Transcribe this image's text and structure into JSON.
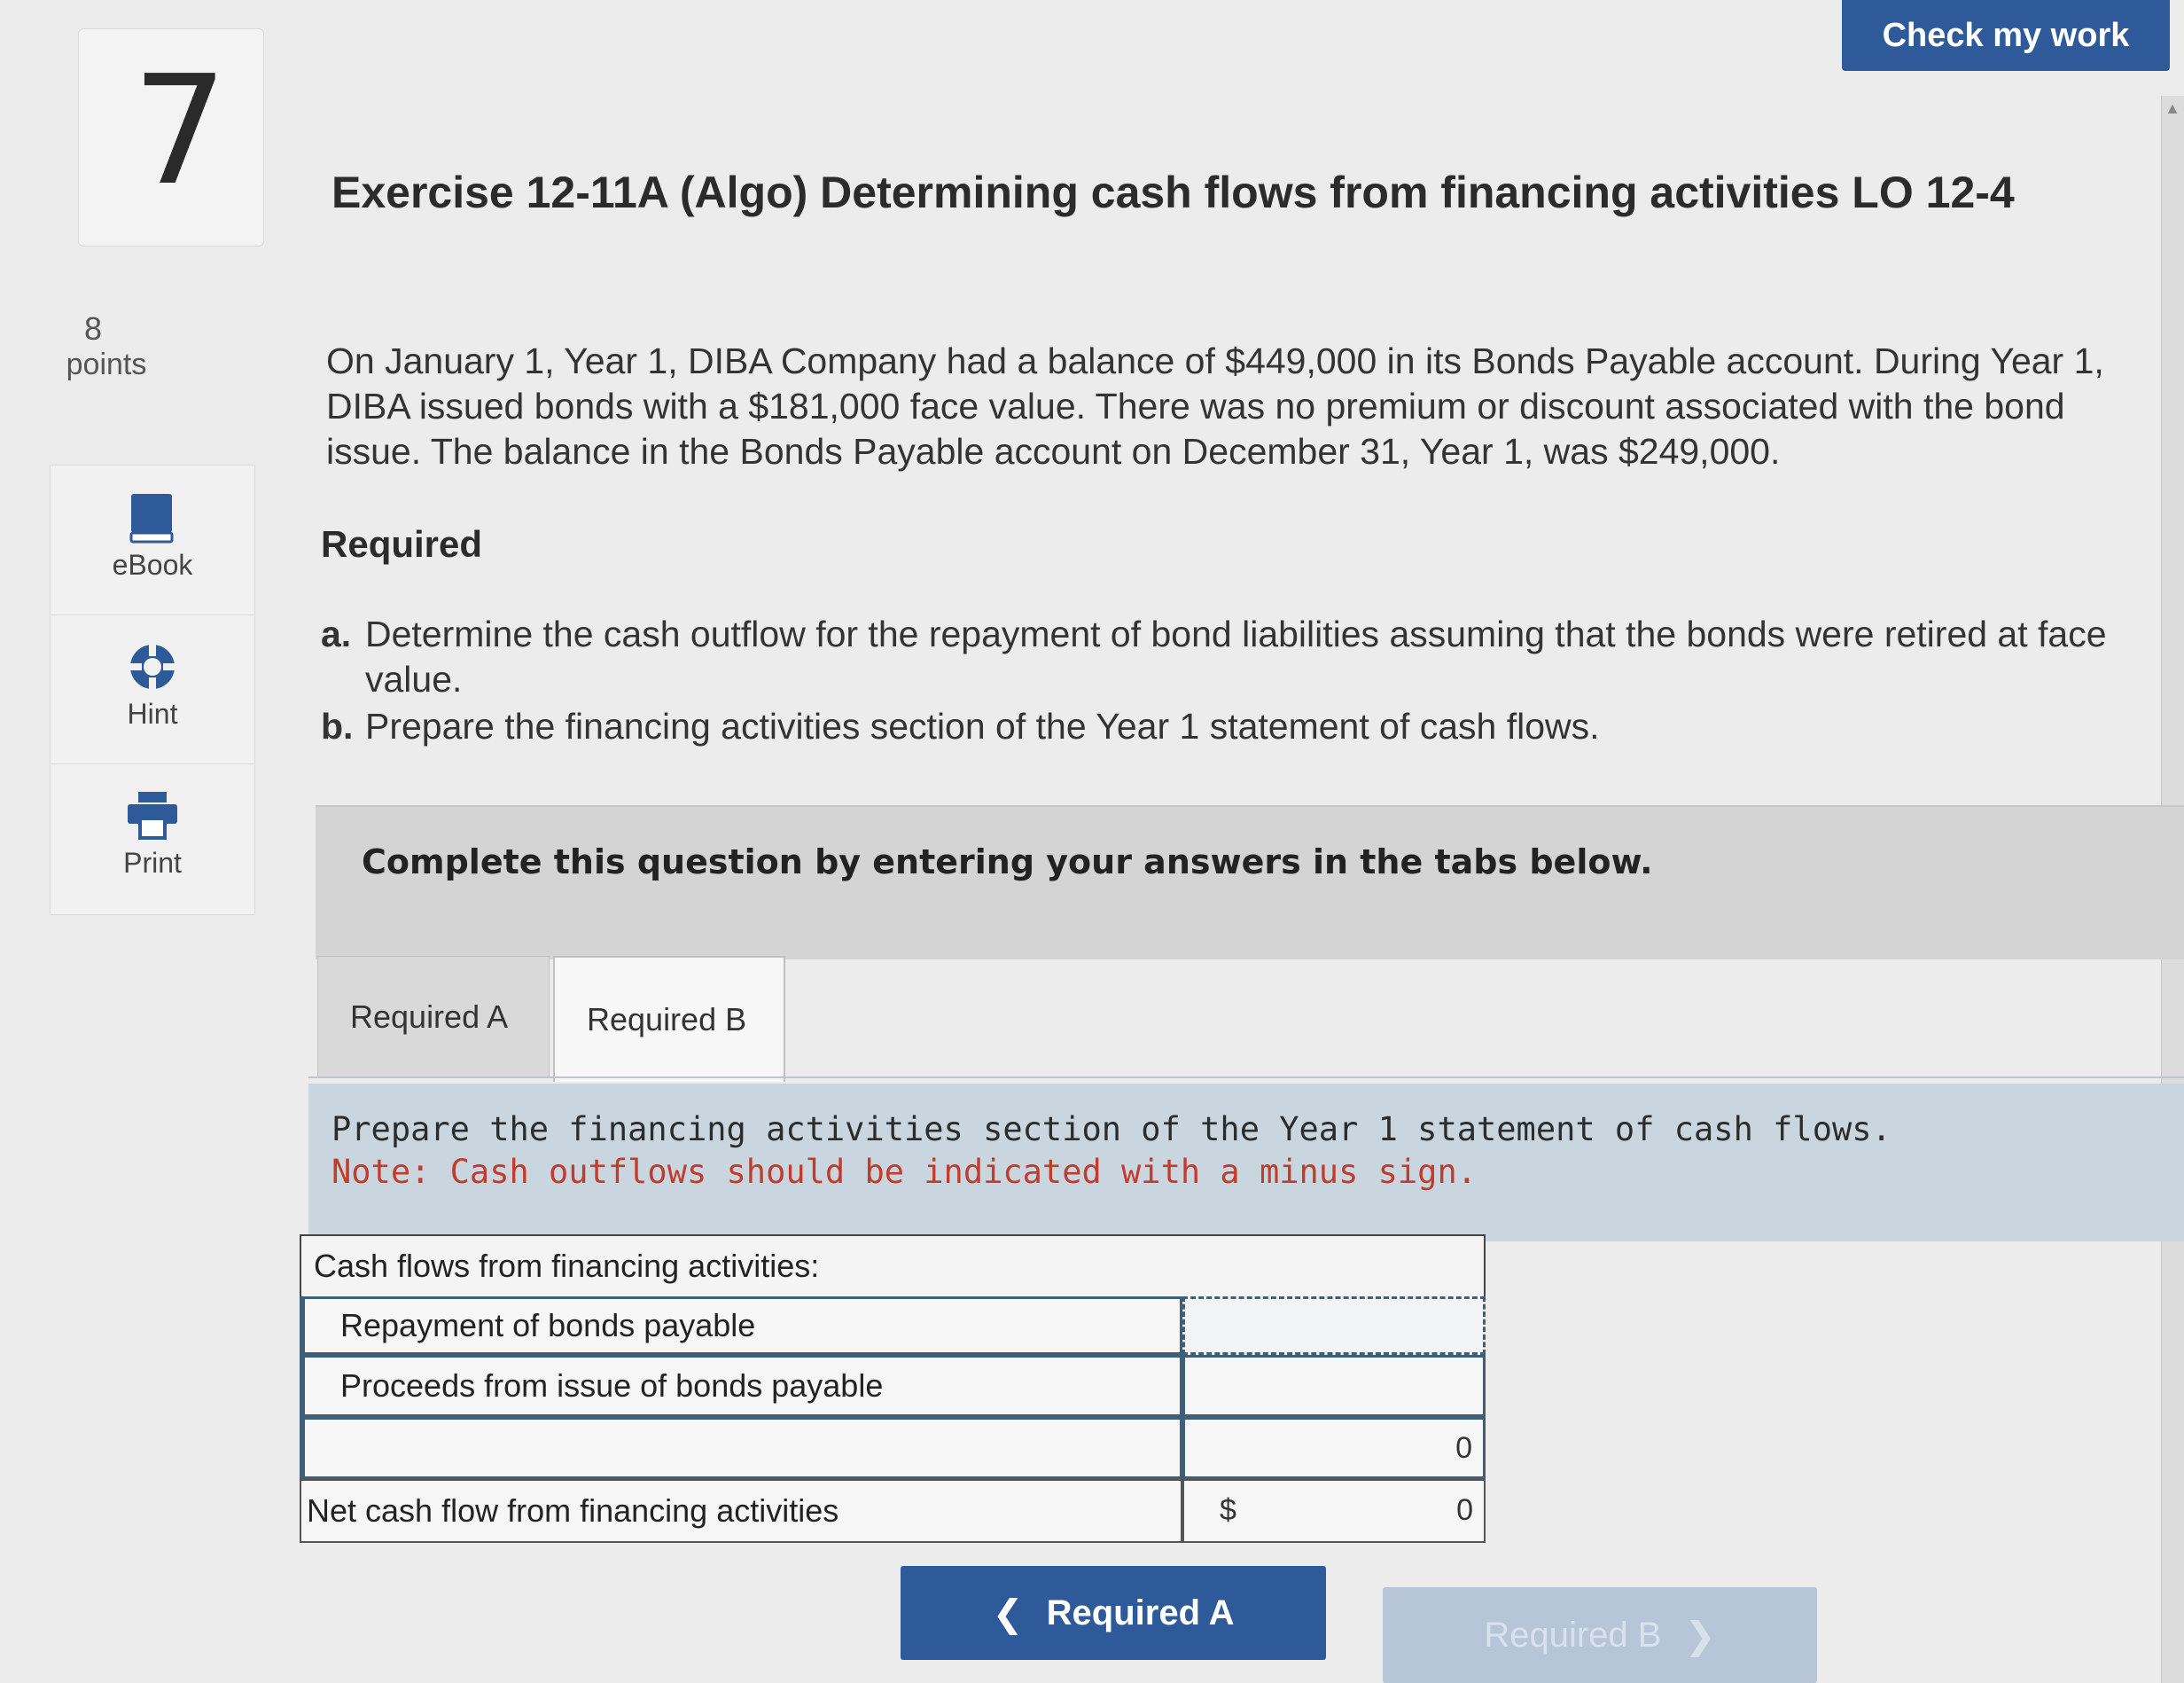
{
  "header": {
    "check_button": "Check my work"
  },
  "question": {
    "number": "7",
    "points_value": "8",
    "points_label": "points"
  },
  "tools": [
    {
      "label": "eBook",
      "icon": "book-icon"
    },
    {
      "label": "Hint",
      "icon": "lifebuoy-icon"
    },
    {
      "label": "Print",
      "icon": "printer-icon"
    }
  ],
  "exercise": {
    "title": "Exercise 12-11A (Algo) Determining cash flows from financing activities LO 12-4",
    "paragraph": "On January 1, Year 1, DIBA Company had a balance of $449,000 in its Bonds Payable account. During Year 1, DIBA issued bonds with a $181,000 face value. There was no premium or discount associated with the bond issue. The balance in the Bonds Payable account on December 31, Year 1, was $249,000.",
    "required_heading": "Required",
    "requirements": [
      {
        "mark": "a.",
        "text": "Determine the cash outflow for the repayment of bond liabilities assuming that the bonds were retired at face value."
      },
      {
        "mark": "b.",
        "text": "Prepare the financing activities section of the Year 1 statement of cash flows."
      }
    ]
  },
  "banner": "Complete this question by entering your answers in the tabs below.",
  "tabs": [
    {
      "label": "Required A",
      "active": false
    },
    {
      "label": "Required B",
      "active": true
    }
  ],
  "instructions": {
    "line1": "Prepare the financing activities section of the Year 1 statement of cash flows.",
    "note": "Note: Cash outflows should be indicated with a minus sign."
  },
  "table": {
    "header": "Cash flows from financing activities:",
    "rows": [
      {
        "label": "Repayment of bonds payable",
        "amount": ""
      },
      {
        "label": "Proceeds from issue of bonds payable",
        "amount": ""
      },
      {
        "label": "",
        "amount": "0"
      }
    ],
    "total": {
      "label": "Net cash flow from financing activities",
      "currency": "$",
      "amount": "0"
    }
  },
  "navigation": {
    "prev_label": "Required A",
    "next_label": "Required B"
  },
  "colors": {
    "primary": "#2e5a9a",
    "note_red": "#c23b2b",
    "instr_bg": "#c9d6e0"
  }
}
